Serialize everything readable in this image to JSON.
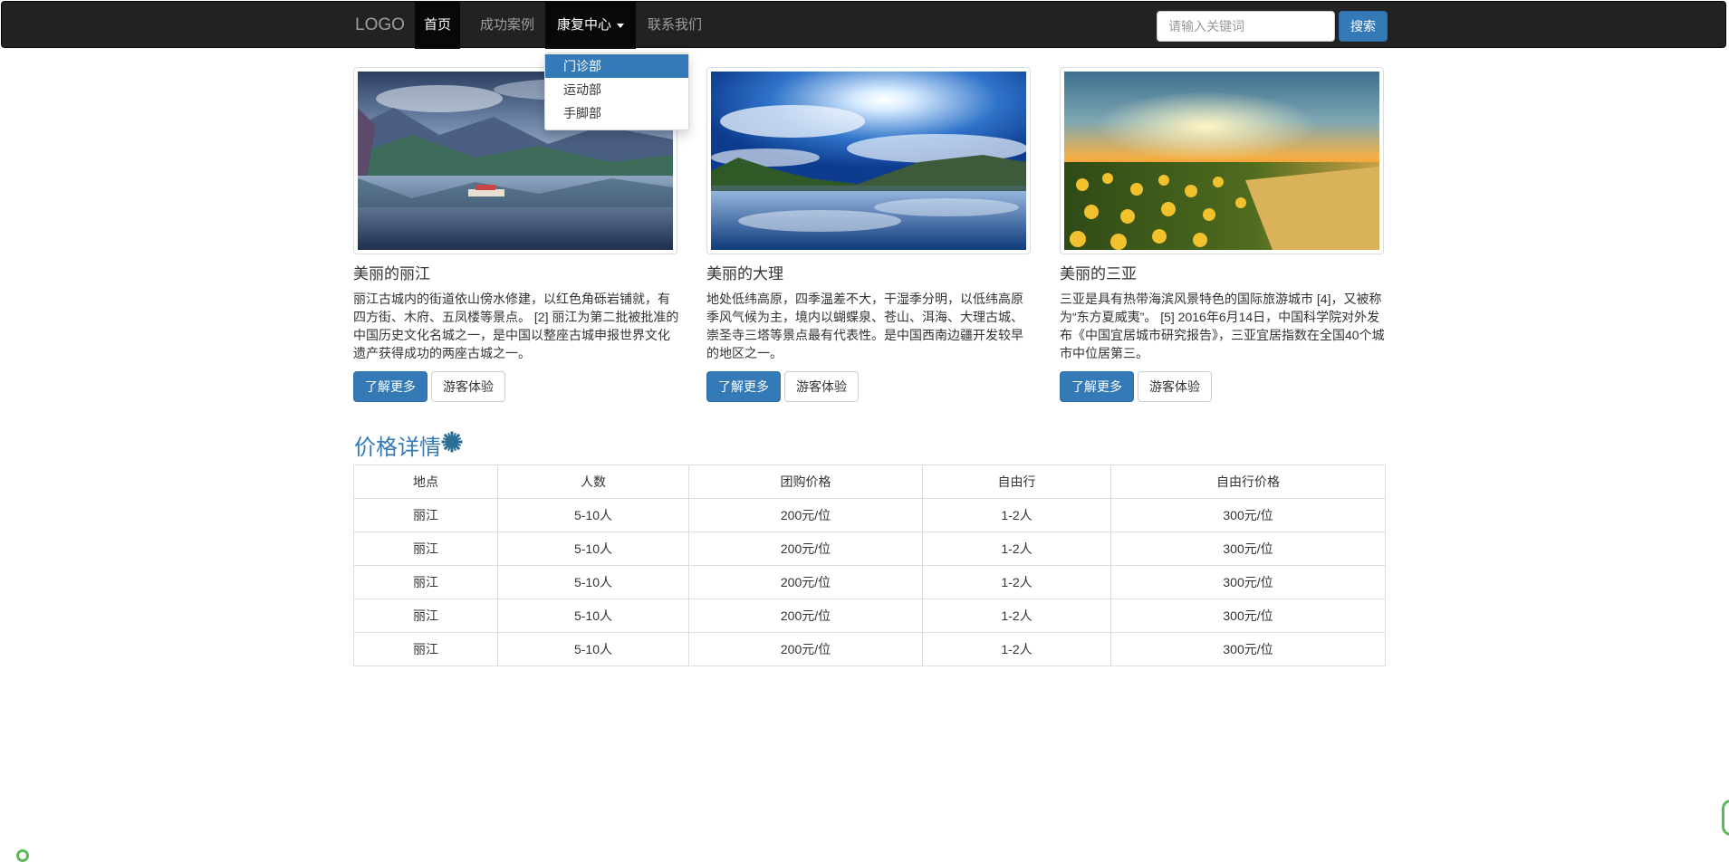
{
  "navbar": {
    "brand": "LOGO",
    "items": [
      {
        "label": "首页",
        "active": true
      },
      {
        "label": "成功案例"
      },
      {
        "label": "康复中心",
        "dropdown": true,
        "open": true
      },
      {
        "label": "联系我们"
      }
    ],
    "search": {
      "placeholder": "请输入关键词",
      "button_label": "搜索"
    }
  },
  "dropdown": {
    "items": [
      {
        "label": "门诊部",
        "active": true
      },
      {
        "label": "运动部"
      },
      {
        "label": "手脚部"
      }
    ]
  },
  "cards": [
    {
      "title": "美丽的丽江",
      "text": "丽江古城内的街道依山傍水修建，以红色角砾岩铺就，有四方街、木府、五凤楼等景点。 [2] 丽江为第二批被批准的中国历史文化名城之一，是中国以整座古城申报世界文化遗产获得成功的两座古城之一。",
      "primary_label": "了解更多",
      "secondary_label": "游客体验"
    },
    {
      "title": "美丽的大理",
      "text": "地处低纬高原，四季温差不大，干湿季分明，以低纬高原季风气候为主，境内以蝴蝶泉、苍山、洱海、大理古城、崇圣寺三塔等景点最有代表性。是中国西南边疆开发较早的地区之一。",
      "primary_label": "了解更多",
      "secondary_label": "游客体验"
    },
    {
      "title": "美丽的三亚",
      "text": "三亚是具有热带海滨风景特色的国际旅游城市 [4]，又被称为“东方夏威夷”。 [5] 2016年6月14日，中国科学院对外发布《中国宜居城市研究报告》，三亚宜居指数在全国40个城市中位居第三。",
      "primary_label": "了解更多",
      "secondary_label": "游客体验"
    }
  ],
  "price_section": {
    "title": "价格详情",
    "icon": "gear-icon",
    "columns": [
      "地点",
      "人数",
      "团购价格",
      "自由行",
      "自由行价格"
    ],
    "rows": [
      [
        "丽江",
        "5-10人",
        "200元/位",
        "1-2人",
        "300元/位"
      ],
      [
        "丽江",
        "5-10人",
        "200元/位",
        "1-2人",
        "300元/位"
      ],
      [
        "丽江",
        "5-10人",
        "200元/位",
        "1-2人",
        "300元/位"
      ],
      [
        "丽江",
        "5-10人",
        "200元/位",
        "1-2人",
        "300元/位"
      ],
      [
        "丽江",
        "5-10人",
        "200元/位",
        "1-2人",
        "300元/位"
      ]
    ]
  },
  "colors": {
    "navbar_bg": "#222222",
    "primary": "#337ab7",
    "accent_green": "#5cb85c"
  }
}
